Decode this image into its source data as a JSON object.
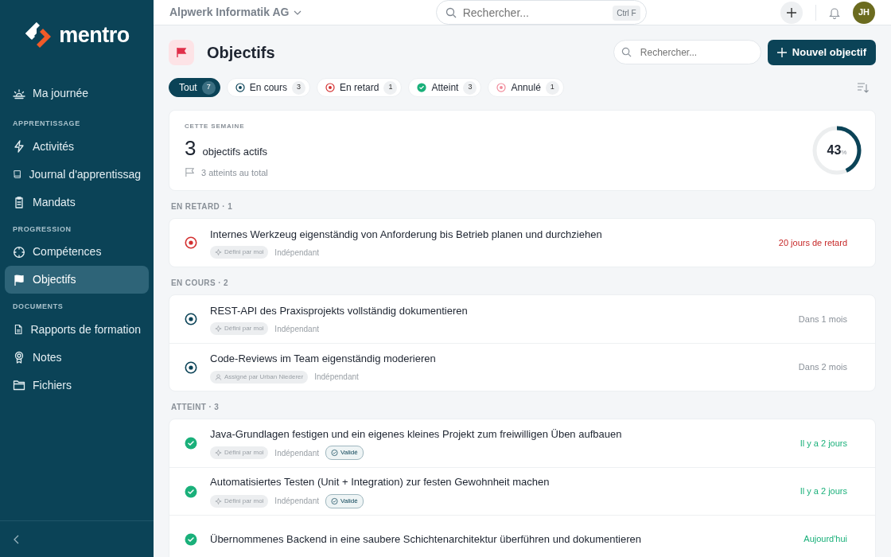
{
  "sidebar": {
    "brand": "mentro",
    "groups": [
      {
        "items": [
          {
            "label": "Ma journée",
            "selected": false
          }
        ]
      },
      {
        "heading": "APPRENTISSAGE",
        "items": [
          {
            "label": "Activités",
            "selected": false
          },
          {
            "label": "Journal d'apprentissag",
            "selected": false
          },
          {
            "label": "Mandats",
            "selected": false
          }
        ]
      },
      {
        "heading": "PROGRESSION",
        "items": [
          {
            "label": "Compétences",
            "selected": false
          },
          {
            "label": "Objectifs",
            "selected": true
          }
        ]
      },
      {
        "heading": "DOCUMENTS",
        "items": [
          {
            "label": "Rapports de formation",
            "selected": false
          },
          {
            "label": "Notes",
            "selected": false
          },
          {
            "label": "Fichiers",
            "selected": false
          }
        ]
      }
    ]
  },
  "topbar": {
    "company": "Alpwerk Informatik AG",
    "search": {
      "placeholder": "Rechercher...",
      "shortcut": "Ctrl F"
    },
    "avatar": "JH"
  },
  "page": {
    "title": "Objectifs",
    "search": {
      "placeholder": "Rechercher..."
    },
    "new_button": "Nouvel objectif"
  },
  "filters": [
    {
      "kind": "all",
      "label": "Tout",
      "count": "7",
      "selected": true
    },
    {
      "kind": "in_progress",
      "label": "En cours",
      "count": "3",
      "selected": false
    },
    {
      "kind": "late",
      "label": "En retard",
      "count": "1",
      "selected": false
    },
    {
      "kind": "done",
      "label": "Atteint",
      "count": "3",
      "selected": false
    },
    {
      "kind": "cancelled",
      "label": "Annulé",
      "count": "1",
      "selected": false
    }
  ],
  "summary": {
    "caption": "CETTE SEMAINE",
    "number": "3",
    "label": "objectifs actifs",
    "total": "3 atteints au total",
    "progress": {
      "value": "43",
      "unit": "%",
      "level": 0.43
    }
  },
  "sections": [
    {
      "heading": "EN RETARD · 1",
      "items": [
        {
          "kind": "late",
          "title": "Internes Werkzeug eigenständig von Anforderung bis Betrieb planen und durchziehen",
          "date": "20 jours de retard",
          "tags": [
            {
              "kind": "self",
              "label": "Défini par moi"
            },
            {
              "kind": "plain",
              "label": "Indépendant"
            }
          ]
        }
      ]
    },
    {
      "heading": "EN COURS · 2",
      "items": [
        {
          "kind": "in_progress",
          "title": "REST-API des Praxisprojekts vollständig dokumentieren",
          "date": "Dans 1 mois",
          "tags": [
            {
              "kind": "self",
              "label": "Défini par moi"
            },
            {
              "kind": "plain",
              "label": "Indépendant"
            }
          ]
        },
        {
          "kind": "in_progress",
          "title": "Code-Reviews im Team eigenständig moderieren",
          "date": "Dans 2 mois",
          "tags": [
            {
              "kind": "assigned",
              "label": "Assigné par Urban Niederer"
            },
            {
              "kind": "plain",
              "label": "Indépendant"
            }
          ]
        }
      ]
    },
    {
      "heading": "ATTEINT · 3",
      "items": [
        {
          "kind": "done",
          "title": "Java-Grundlagen festigen und ein eigenes kleines Projekt zum freiwilligen Üben aufbauen",
          "date": "Il y a 2 jours",
          "tags": [
            {
              "kind": "self",
              "label": "Défini par moi"
            },
            {
              "kind": "plain",
              "label": "Indépendant"
            },
            {
              "kind": "validated",
              "label": "Validé"
            }
          ]
        },
        {
          "kind": "done",
          "title": "Automatisiertes Testen (Unit + Integration) zur festen Gewohnheit machen",
          "date": "Il y a 2 jours",
          "tags": [
            {
              "kind": "self",
              "label": "Défini par moi"
            },
            {
              "kind": "plain",
              "label": "Indépendant"
            },
            {
              "kind": "validated",
              "label": "Validé"
            }
          ]
        },
        {
          "kind": "done",
          "title": "Übernommenes Backend in eine saubere Schichtenarchitektur überführen und dokumentieren",
          "date": "Aujourd'hui"
        }
      ]
    }
  ]
}
